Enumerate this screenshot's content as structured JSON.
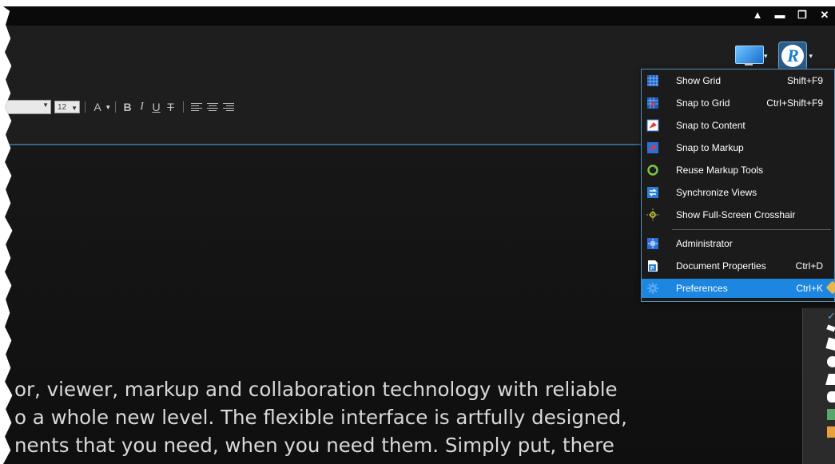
{
  "window": {
    "controls": [
      "ribbon-collapse",
      "minimize",
      "restore",
      "close"
    ]
  },
  "toolbar": {
    "font_size": "12",
    "format_buttons": [
      "A",
      "B",
      "I",
      "U",
      "T"
    ]
  },
  "menu": {
    "items": [
      {
        "label": "Show Grid",
        "shortcut": "Shift+F9",
        "icon": "grid-icon"
      },
      {
        "label": "Snap to Grid",
        "shortcut": "Ctrl+Shift+F9",
        "icon": "snap-grid-icon"
      },
      {
        "label": "Snap to Content",
        "shortcut": "",
        "icon": "snap-content-icon"
      },
      {
        "label": "Snap to Markup",
        "shortcut": "",
        "icon": "snap-markup-icon"
      },
      {
        "label": "Reuse Markup Tools",
        "shortcut": "",
        "icon": "reuse-tools-icon"
      },
      {
        "label": "Synchronize Views",
        "shortcut": "",
        "icon": "sync-views-icon"
      },
      {
        "label": "Show Full-Screen Crosshair",
        "shortcut": "",
        "icon": "crosshair-icon"
      },
      {
        "label": "Administrator",
        "shortcut": "",
        "icon": "administrator-icon"
      },
      {
        "label": "Document Properties",
        "shortcut": "Ctrl+D",
        "icon": "document-properties-icon"
      },
      {
        "label": "Preferences",
        "shortcut": "Ctrl+K",
        "icon": "preferences-icon"
      }
    ],
    "highlighted": "Preferences"
  },
  "document": {
    "lines": [
      "or, viewer, markup and collaboration technology with reliable",
      "o a whole new level. The flexible interface is artfully designed,",
      "nents that you need, when you need them. Simply put, there"
    ]
  },
  "colors": {
    "highlight": "#1c86e0",
    "menu_border": "#5a8fb5",
    "background": "#161616"
  }
}
